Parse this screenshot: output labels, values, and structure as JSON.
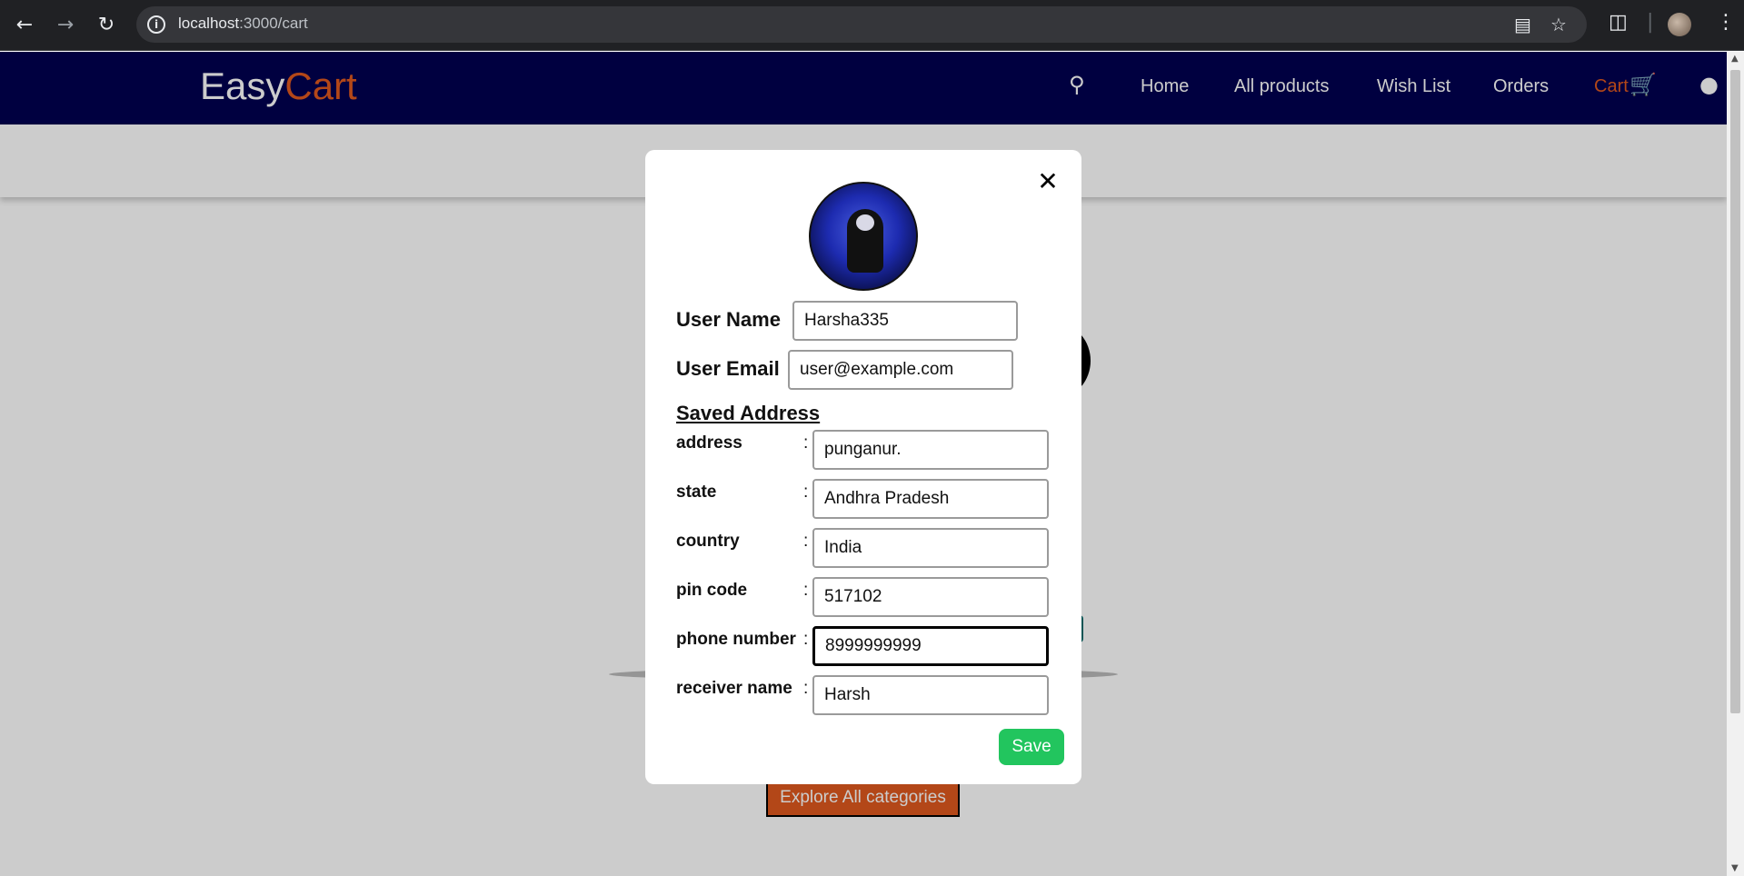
{
  "browser": {
    "url_host": "localhost",
    "url_path": ":3000/cart"
  },
  "navbar": {
    "logo_part1": "Easy",
    "logo_part2": "Cart",
    "links": [
      "Home",
      "All products",
      "Wish List",
      "Orders",
      "Cart"
    ]
  },
  "background": {
    "explore_button": "Explore All categories"
  },
  "modal": {
    "user_name_label": "User Name",
    "user_name_value": "Harsha335",
    "user_email_label": "User Email",
    "user_email_value": "user@example.com",
    "saved_address_title": "Saved Address",
    "address_fields": [
      {
        "label": "address",
        "value": "punganur."
      },
      {
        "label": "state",
        "value": "Andhra Pradesh"
      },
      {
        "label": "country",
        "value": "India"
      },
      {
        "label": "pin code",
        "value": "517102"
      },
      {
        "label": "phone number",
        "value": "8999999999"
      },
      {
        "label": "receiver name",
        "value": "Harsh"
      }
    ],
    "colon": ":",
    "save_label": "Save"
  },
  "colors": {
    "navbar": "#000050",
    "accent": "#e0591f",
    "save": "#22c55e"
  }
}
